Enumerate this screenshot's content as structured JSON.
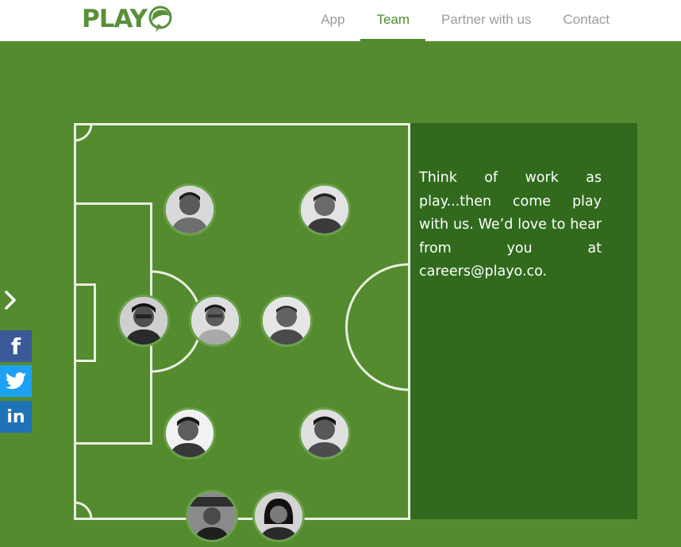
{
  "header": {
    "logo_text": "PLAY",
    "nav": [
      {
        "label": "App",
        "active": false
      },
      {
        "label": "Team",
        "active": true
      },
      {
        "label": "Partner with us",
        "active": false
      },
      {
        "label": "Contact",
        "active": false
      }
    ]
  },
  "panel": {
    "text": "Think of work as play...then come play with us. We’d love to hear from you at",
    "email": "careers@playo.co."
  },
  "share": {
    "facebook": "f",
    "linkedin": "in"
  },
  "icons": {
    "expand": "chevron-right-icon",
    "facebook": "facebook-icon",
    "twitter": "twitter-icon",
    "linkedin": "linkedin-icon"
  },
  "colors": {
    "brand": "#5a8f3a",
    "field": "#548b2f",
    "panel": "#316a1d",
    "nav_active": "#4f8a2d",
    "facebook": "#3b5998",
    "twitter": "#1da1f2",
    "linkedin": "#1f72b6"
  }
}
